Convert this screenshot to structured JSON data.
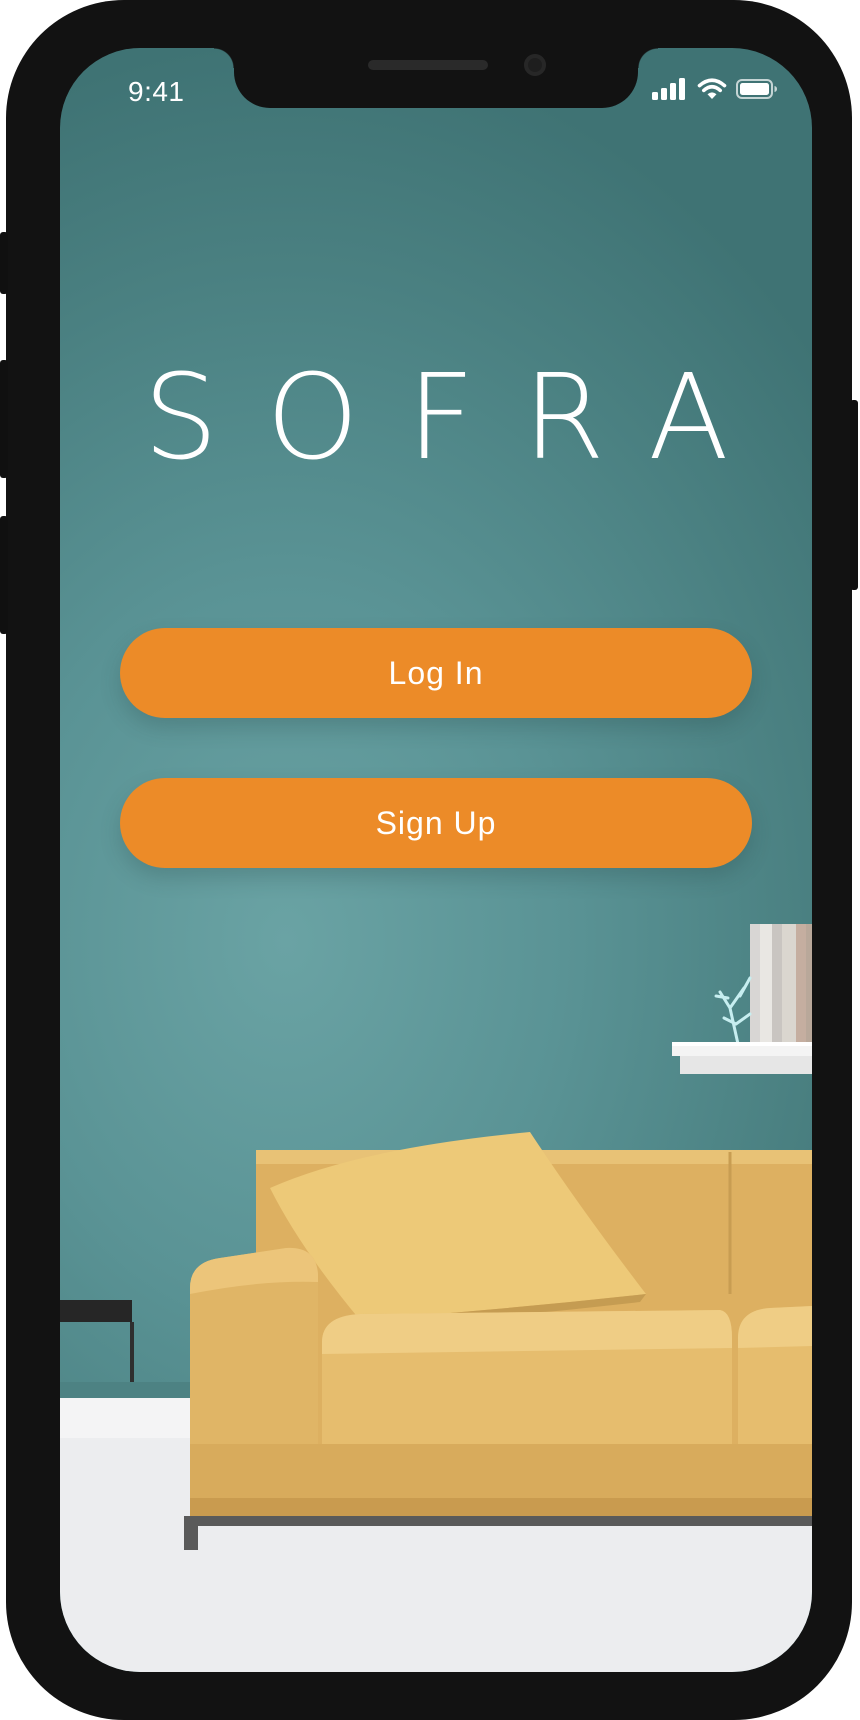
{
  "status_bar": {
    "time": "9:41",
    "icons": [
      "cellular-signal-icon",
      "wifi-icon",
      "battery-icon"
    ]
  },
  "app": {
    "title": "SOFRA"
  },
  "buttons": {
    "login_label": "Log In",
    "signup_label": "Sign Up"
  },
  "colors": {
    "button": "#ec8b28",
    "wall": "#5a9395",
    "sofa": "#e3b865",
    "text": "#ffffff"
  }
}
